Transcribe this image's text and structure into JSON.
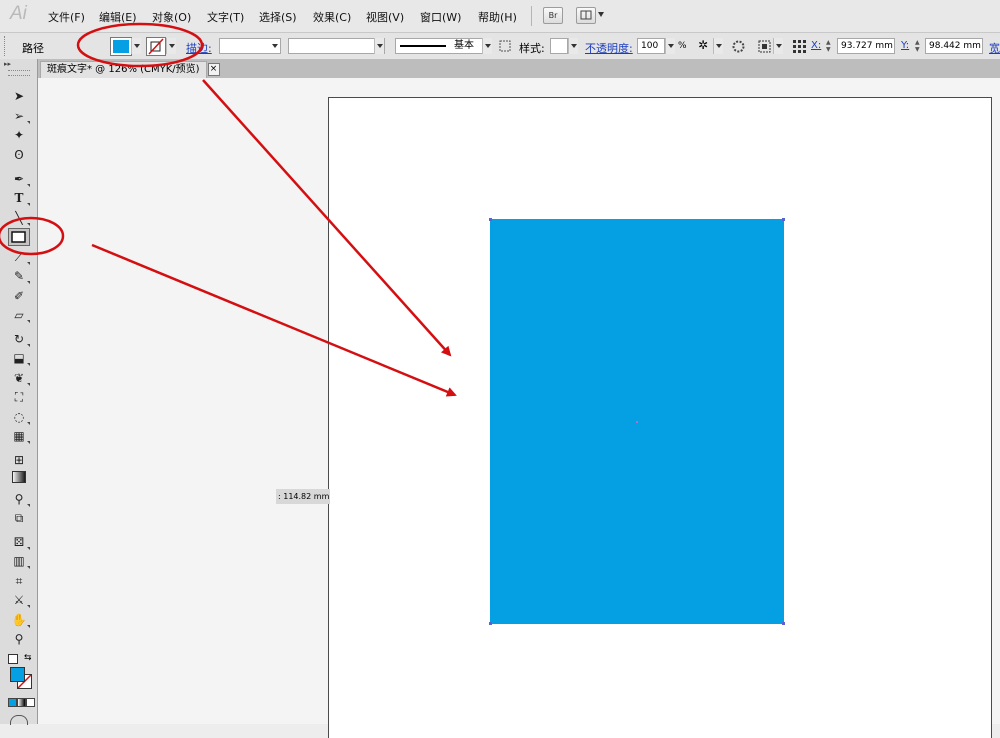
{
  "app": {
    "logo": "Ai"
  },
  "menu": [
    "文件(F)",
    "编辑(E)",
    "对象(O)",
    "文字(T)",
    "选择(S)",
    "效果(C)",
    "视图(V)",
    "窗口(W)",
    "帮助(H)"
  ],
  "bridge_button": "Br",
  "control_bar": {
    "object_type": "路径",
    "fill_color": "#059fe3",
    "stroke_label": "描边:",
    "stroke_profile": "基本",
    "style_label": "样式:",
    "opacity_label": "不透明度:",
    "opacity_value": "100",
    "opacity_unit": "%",
    "x_label": "X:",
    "x_value": "93.727 mm",
    "y_label": "Y:",
    "y_value": "98.442 mm",
    "w_label": "宽"
  },
  "document_tab": {
    "title": "斑痕文字* @ 126% (CMYK/预览)",
    "close": "×"
  },
  "canvas": {
    "measure_label": ": 114.82 mm",
    "shape_fill": "#059fe3"
  },
  "toolbox": {
    "tools": [
      "selection-tool",
      "direct-selection-tool",
      "magic-wand-tool",
      "lasso-tool",
      "pen-tool",
      "type-tool",
      "line-segment-tool",
      "rectangle-tool",
      "paintbrush-tool",
      "pencil-tool",
      "blob-brush-tool",
      "eraser-tool",
      "rotate-tool",
      "scale-tool",
      "warp-tool",
      "free-transform-tool",
      "shape-builder-tool",
      "perspective-grid-tool",
      "mesh-tool",
      "gradient-tool",
      "eyedropper-tool",
      "blend-tool",
      "symbol-sprayer-tool",
      "column-graph-tool",
      "artboard-tool",
      "slice-tool",
      "hand-tool",
      "zoom-tool"
    ]
  },
  "annotation_color": "#d40f12"
}
